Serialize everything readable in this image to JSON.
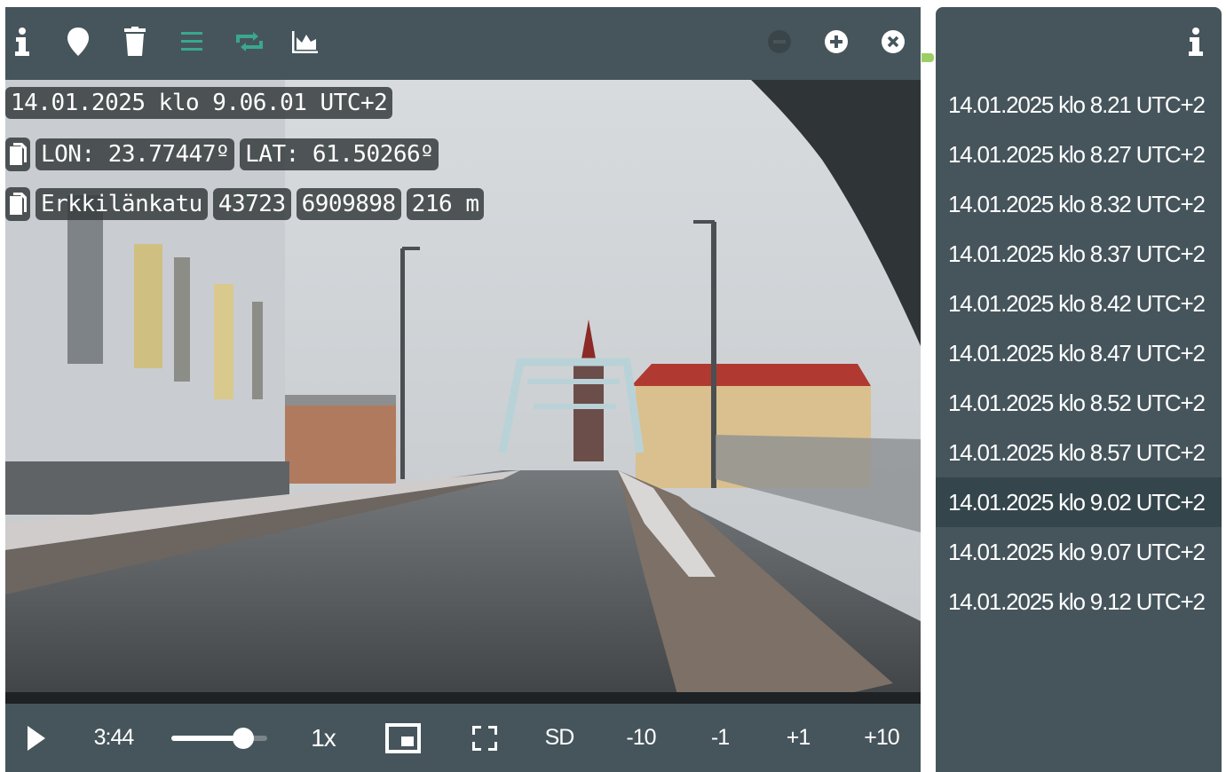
{
  "toolbar": {
    "buttons": [
      {
        "icon": "info-icon",
        "color": "#ffffff"
      },
      {
        "icon": "map-pin-icon",
        "color": "#ffffff"
      },
      {
        "icon": "trash-icon",
        "color": "#ffffff"
      },
      {
        "icon": "list-icon",
        "color": "#3aa78f"
      },
      {
        "icon": "repeat-icon",
        "color": "#3aa78f"
      },
      {
        "icon": "chart-icon",
        "color": "#ffffff"
      }
    ],
    "zoom_out_icon": "minus-circle-icon",
    "zoom_in_icon": "plus-circle-icon",
    "close_icon": "close-circle-icon"
  },
  "overlay": {
    "timestamp": "14.01.2025 klo 9.06.01 UTC+2",
    "lon": "LON: 23.77447º",
    "lat": "LAT: 61.50266º",
    "street": "Erkkilänkatu",
    "code1": "43723",
    "code2": "6909898",
    "distance": "216 m"
  },
  "controls": {
    "time": "3:44",
    "volume_level": 0.75,
    "speed": "1x",
    "quality": "SD",
    "skip_back_10": "-10",
    "skip_back_1": "-1",
    "skip_fwd_1": "+1",
    "skip_fwd_10": "+10"
  },
  "list": {
    "items": [
      "14.01.2025 klo 8.21 UTC+2",
      "14.01.2025 klo 8.27 UTC+2",
      "14.01.2025 klo 8.32 UTC+2",
      "14.01.2025 klo 8.37 UTC+2",
      "14.01.2025 klo 8.42 UTC+2",
      "14.01.2025 klo 8.47 UTC+2",
      "14.01.2025 klo 8.52 UTC+2",
      "14.01.2025 klo 8.57 UTC+2",
      "14.01.2025 klo 9.02 UTC+2",
      "14.01.2025 klo 9.07 UTC+2",
      "14.01.2025 klo 9.12 UTC+2"
    ],
    "selected_index": 8
  },
  "colors": {
    "panel": "#46555c",
    "selected": "#35454c",
    "accent_green": "#3aa78f",
    "edge_green": "#9ccf63"
  }
}
